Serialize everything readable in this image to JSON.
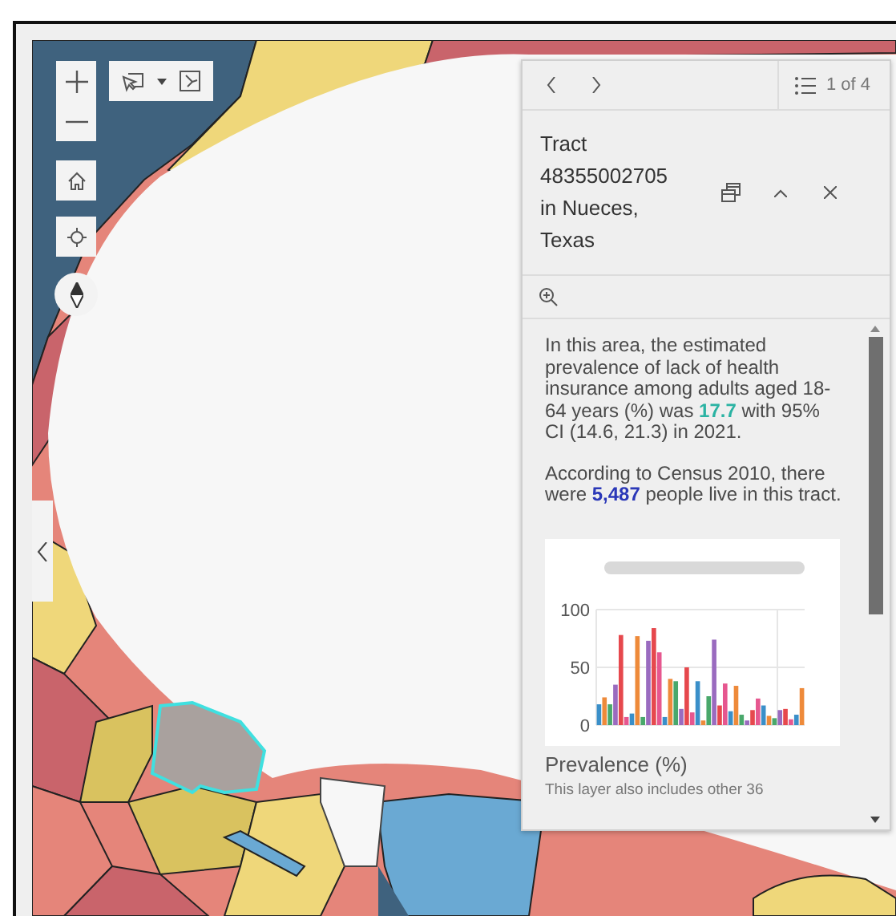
{
  "popup": {
    "pager": "1 of 4",
    "title": "Tract 48355002705 in Nueces, Texas",
    "paragraphs": [
      [
        {
          "text": "In this area, the estimated prevalence of lack of health insurance among adults aged 18-64 years (%) was "
        },
        {
          "text": "17.7",
          "color": "#2bb3a3"
        },
        {
          "text": " with 95% CI (14.6, 21.3) in 2021."
        }
      ],
      [
        {
          "text": "According to Census 2010, there were "
        },
        {
          "text": "5,487",
          "color": "#2b38b8"
        },
        {
          "text": " people live in this tract."
        }
      ]
    ],
    "chart_data": {
      "type": "bar",
      "ylim": [
        0,
        100
      ],
      "yticks": [
        0,
        50,
        100
      ],
      "values": [
        18,
        24,
        18,
        35,
        78,
        7,
        10,
        77,
        7,
        73,
        84,
        63,
        7,
        40,
        38,
        14,
        50,
        11,
        38,
        4,
        25,
        74,
        17,
        36,
        12,
        34,
        9,
        4,
        13,
        23,
        17,
        8,
        6,
        13,
        14,
        5,
        9,
        32
      ]
    },
    "chart_caption": "Prevalence (%)",
    "footer_note": "This layer also includes other 36"
  }
}
